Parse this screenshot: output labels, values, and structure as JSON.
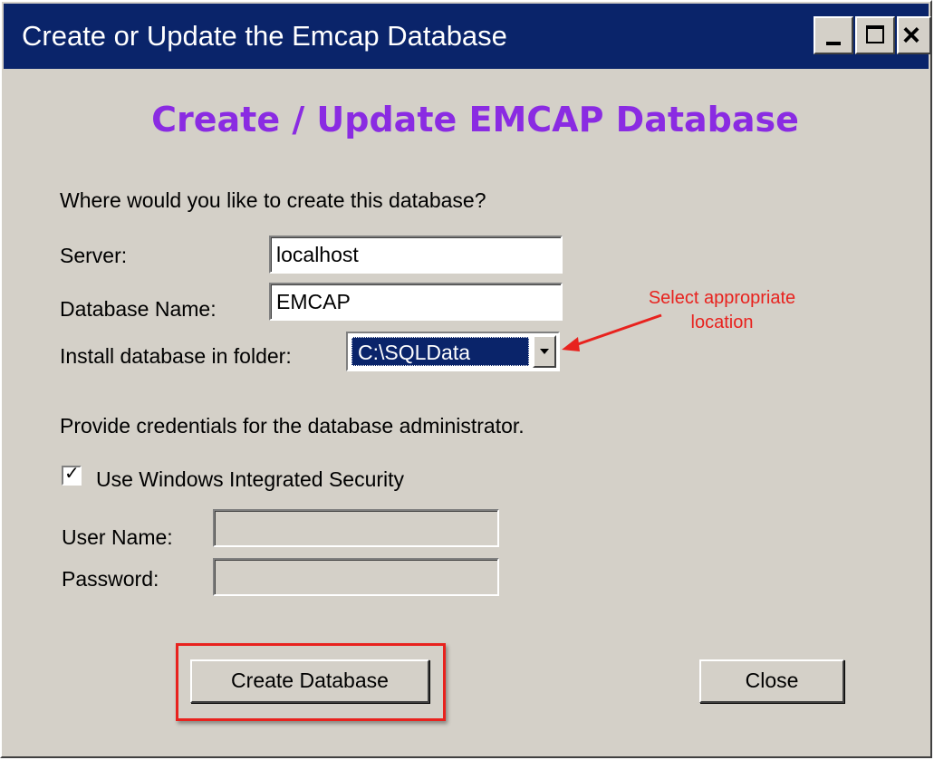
{
  "window": {
    "title": "Create or Update the Emcap Database",
    "minimize_symbol": "_",
    "maximize_symbol": "□",
    "close_symbol": "×"
  },
  "heading": "Create / Update EMCAP Database",
  "location_prompt": "Where would you like to create this database?",
  "server": {
    "label": "Server:",
    "value": "localhost"
  },
  "database_name": {
    "label": "Database Name:",
    "value": "EMCAP"
  },
  "install_folder": {
    "label": "Install database in folder:",
    "value": "C:\\SQLData"
  },
  "annotation": {
    "text": "Select appropriate location",
    "color": "#e8221e"
  },
  "credentials_prompt": "Provide credentials for the database administrator.",
  "windows_security": {
    "label": "Use Windows Integrated Security",
    "checked": true,
    "check_symbol": "✓"
  },
  "user_name": {
    "label": "User Name:",
    "value": ""
  },
  "password": {
    "label": "Password:",
    "value": ""
  },
  "buttons": {
    "create": "Create Database",
    "close": "Close"
  },
  "colors": {
    "titlebar": "#0a246a",
    "heading": "#8a2be2",
    "dialog_background": "#d4d0c8",
    "highlight": "#e8221e"
  }
}
